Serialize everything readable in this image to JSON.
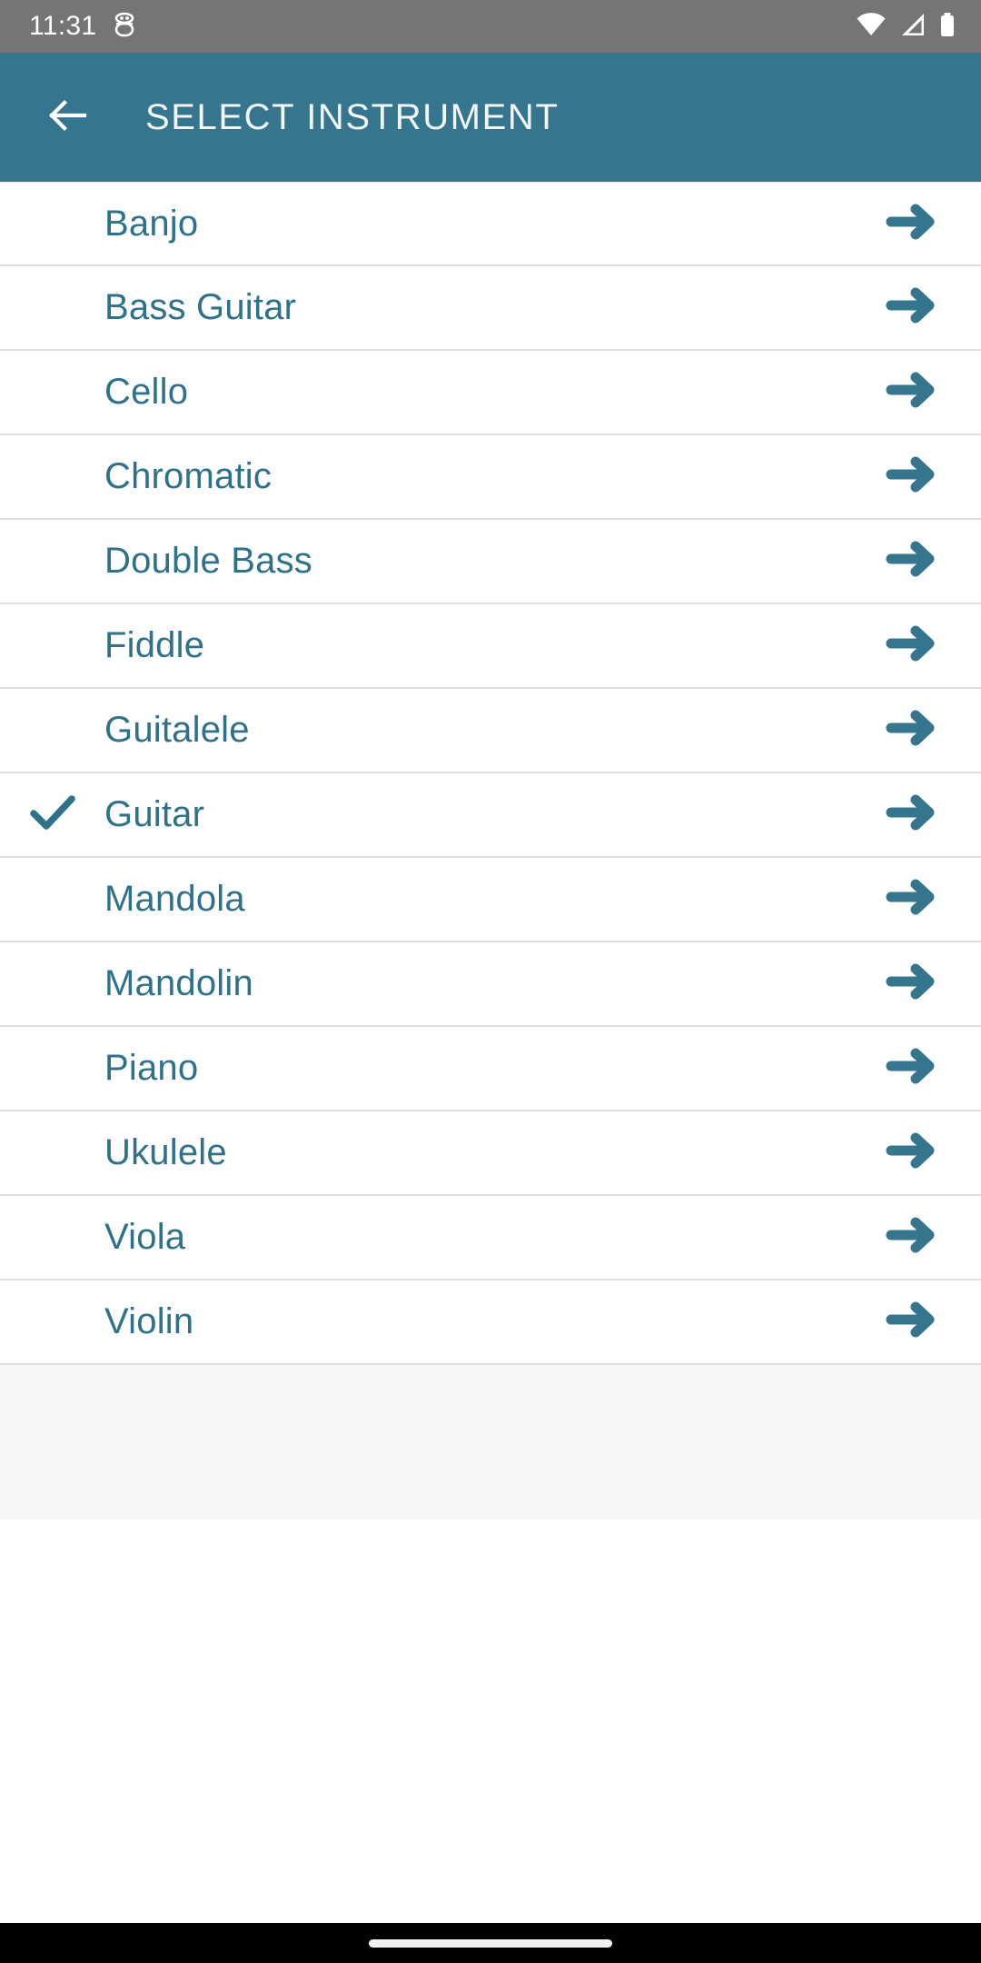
{
  "status_bar": {
    "time": "11:31",
    "left_icons": [
      {
        "name": "android-debug-icon"
      }
    ],
    "right_icons": [
      {
        "name": "wifi-icon"
      },
      {
        "name": "cellular-signal-icon"
      },
      {
        "name": "battery-icon"
      }
    ],
    "background_color": "#757575",
    "foreground_color": "#FFFFFF"
  },
  "app_bar": {
    "title": "SELECT INSTRUMENT",
    "back_icon": "arrow-left-icon",
    "background_color": "#35758D",
    "title_color": "#F2F6F7"
  },
  "theme": {
    "accent": "#2E7189",
    "arrow_color": "#35758D",
    "divider": "#DEDEDE",
    "row_background": "#FFFFFF",
    "footer_background": "#F7F7F7",
    "nav_background": "#000000"
  },
  "list": {
    "selected": "Guitar",
    "items": [
      {
        "label": "Banjo",
        "selected": false,
        "arrow_icon": "arrow-right-icon"
      },
      {
        "label": "Bass Guitar",
        "selected": false,
        "arrow_icon": "arrow-right-icon"
      },
      {
        "label": "Cello",
        "selected": false,
        "arrow_icon": "arrow-right-icon"
      },
      {
        "label": "Chromatic",
        "selected": false,
        "arrow_icon": "arrow-right-icon"
      },
      {
        "label": "Double Bass",
        "selected": false,
        "arrow_icon": "arrow-right-icon"
      },
      {
        "label": "Fiddle",
        "selected": false,
        "arrow_icon": "arrow-right-icon"
      },
      {
        "label": "Guitalele",
        "selected": false,
        "arrow_icon": "arrow-right-icon"
      },
      {
        "label": "Guitar",
        "selected": true,
        "arrow_icon": "arrow-right-icon",
        "check_icon": "check-icon"
      },
      {
        "label": "Mandola",
        "selected": false,
        "arrow_icon": "arrow-right-icon"
      },
      {
        "label": "Mandolin",
        "selected": false,
        "arrow_icon": "arrow-right-icon"
      },
      {
        "label": "Piano",
        "selected": false,
        "arrow_icon": "arrow-right-icon"
      },
      {
        "label": "Ukulele",
        "selected": false,
        "arrow_icon": "arrow-right-icon"
      },
      {
        "label": "Viola",
        "selected": false,
        "arrow_icon": "arrow-right-icon"
      },
      {
        "label": "Violin",
        "selected": false,
        "arrow_icon": "arrow-right-icon"
      }
    ]
  },
  "navigation_bar": {
    "gesture_pill": "home-gesture-pill"
  }
}
